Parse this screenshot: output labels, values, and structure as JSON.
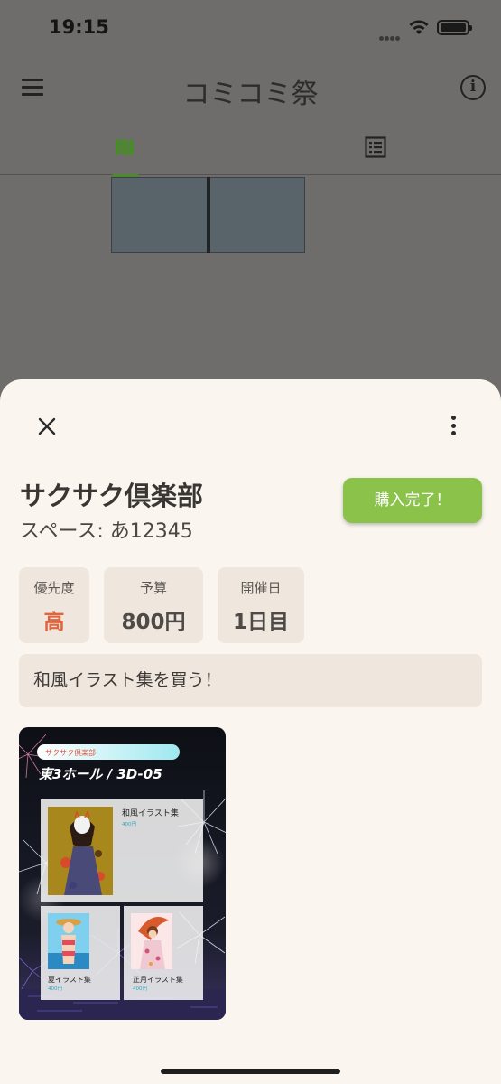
{
  "status_bar": {
    "time": "19:15"
  },
  "app_bar": {
    "title": "コミコミ祭"
  },
  "tabs": [
    {
      "name": "map",
      "icon": "map-icon",
      "selected": true
    },
    {
      "name": "list",
      "icon": "list-icon",
      "selected": false
    }
  ],
  "detail": {
    "circle_name": "サクサク倶楽部",
    "space": "スペース: あ12345",
    "purchase_button": "購入完了！",
    "priority": {
      "label": "優先度",
      "value": "高"
    },
    "budget": {
      "label": "予算",
      "value": "800円"
    },
    "day": {
      "label": "開催日",
      "value": "1日目"
    },
    "memo": "和風イラスト集を買う！"
  },
  "cut": {
    "circle_tag": "サクサク倶楽部",
    "location": "東3ホール / 3D-05",
    "items": [
      {
        "title": "和風イラスト集",
        "price": "400円"
      },
      {
        "title": "夏イラスト集",
        "price": "400円"
      },
      {
        "title": "正月イラスト集",
        "price": "400円"
      }
    ]
  },
  "colors": {
    "accent_green": "#8bc34a",
    "priority_red": "#e2643d",
    "sheet_bg": "#faf5ef",
    "card_bg": "#efe7dd"
  }
}
